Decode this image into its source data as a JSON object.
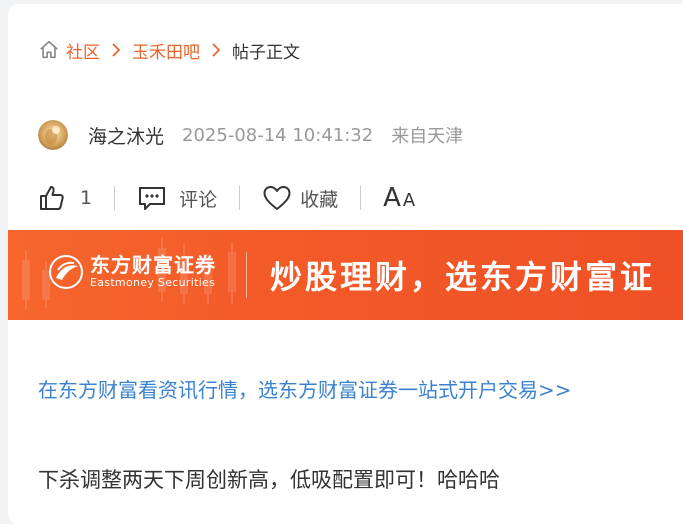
{
  "breadcrumb": {
    "items": [
      {
        "label": "社区"
      },
      {
        "label": "玉禾田吧"
      }
    ],
    "current": "帖子正文"
  },
  "author": {
    "name": "海之沐光",
    "time": "2025-08-14 10:41:32",
    "location": "来自天津"
  },
  "actions": {
    "like_count": "1",
    "comment_label": "评论",
    "favorite_label": "收藏",
    "font_large": "A",
    "font_small": "A"
  },
  "banner": {
    "brand_cn": "东方财富证券",
    "brand_en": "Eastmoney Securities",
    "slogan": "炒股理财，选东方财富证"
  },
  "promo": {
    "text": "在东方财富看资讯行情，选东方财富证券一站式开户交易>>"
  },
  "post": {
    "content": "下杀调整两天下周创新高，低吸配置即可！哈哈哈"
  },
  "colors": {
    "accent": "#e8642c",
    "link": "#3a82d0",
    "banner": "#f25a28"
  }
}
